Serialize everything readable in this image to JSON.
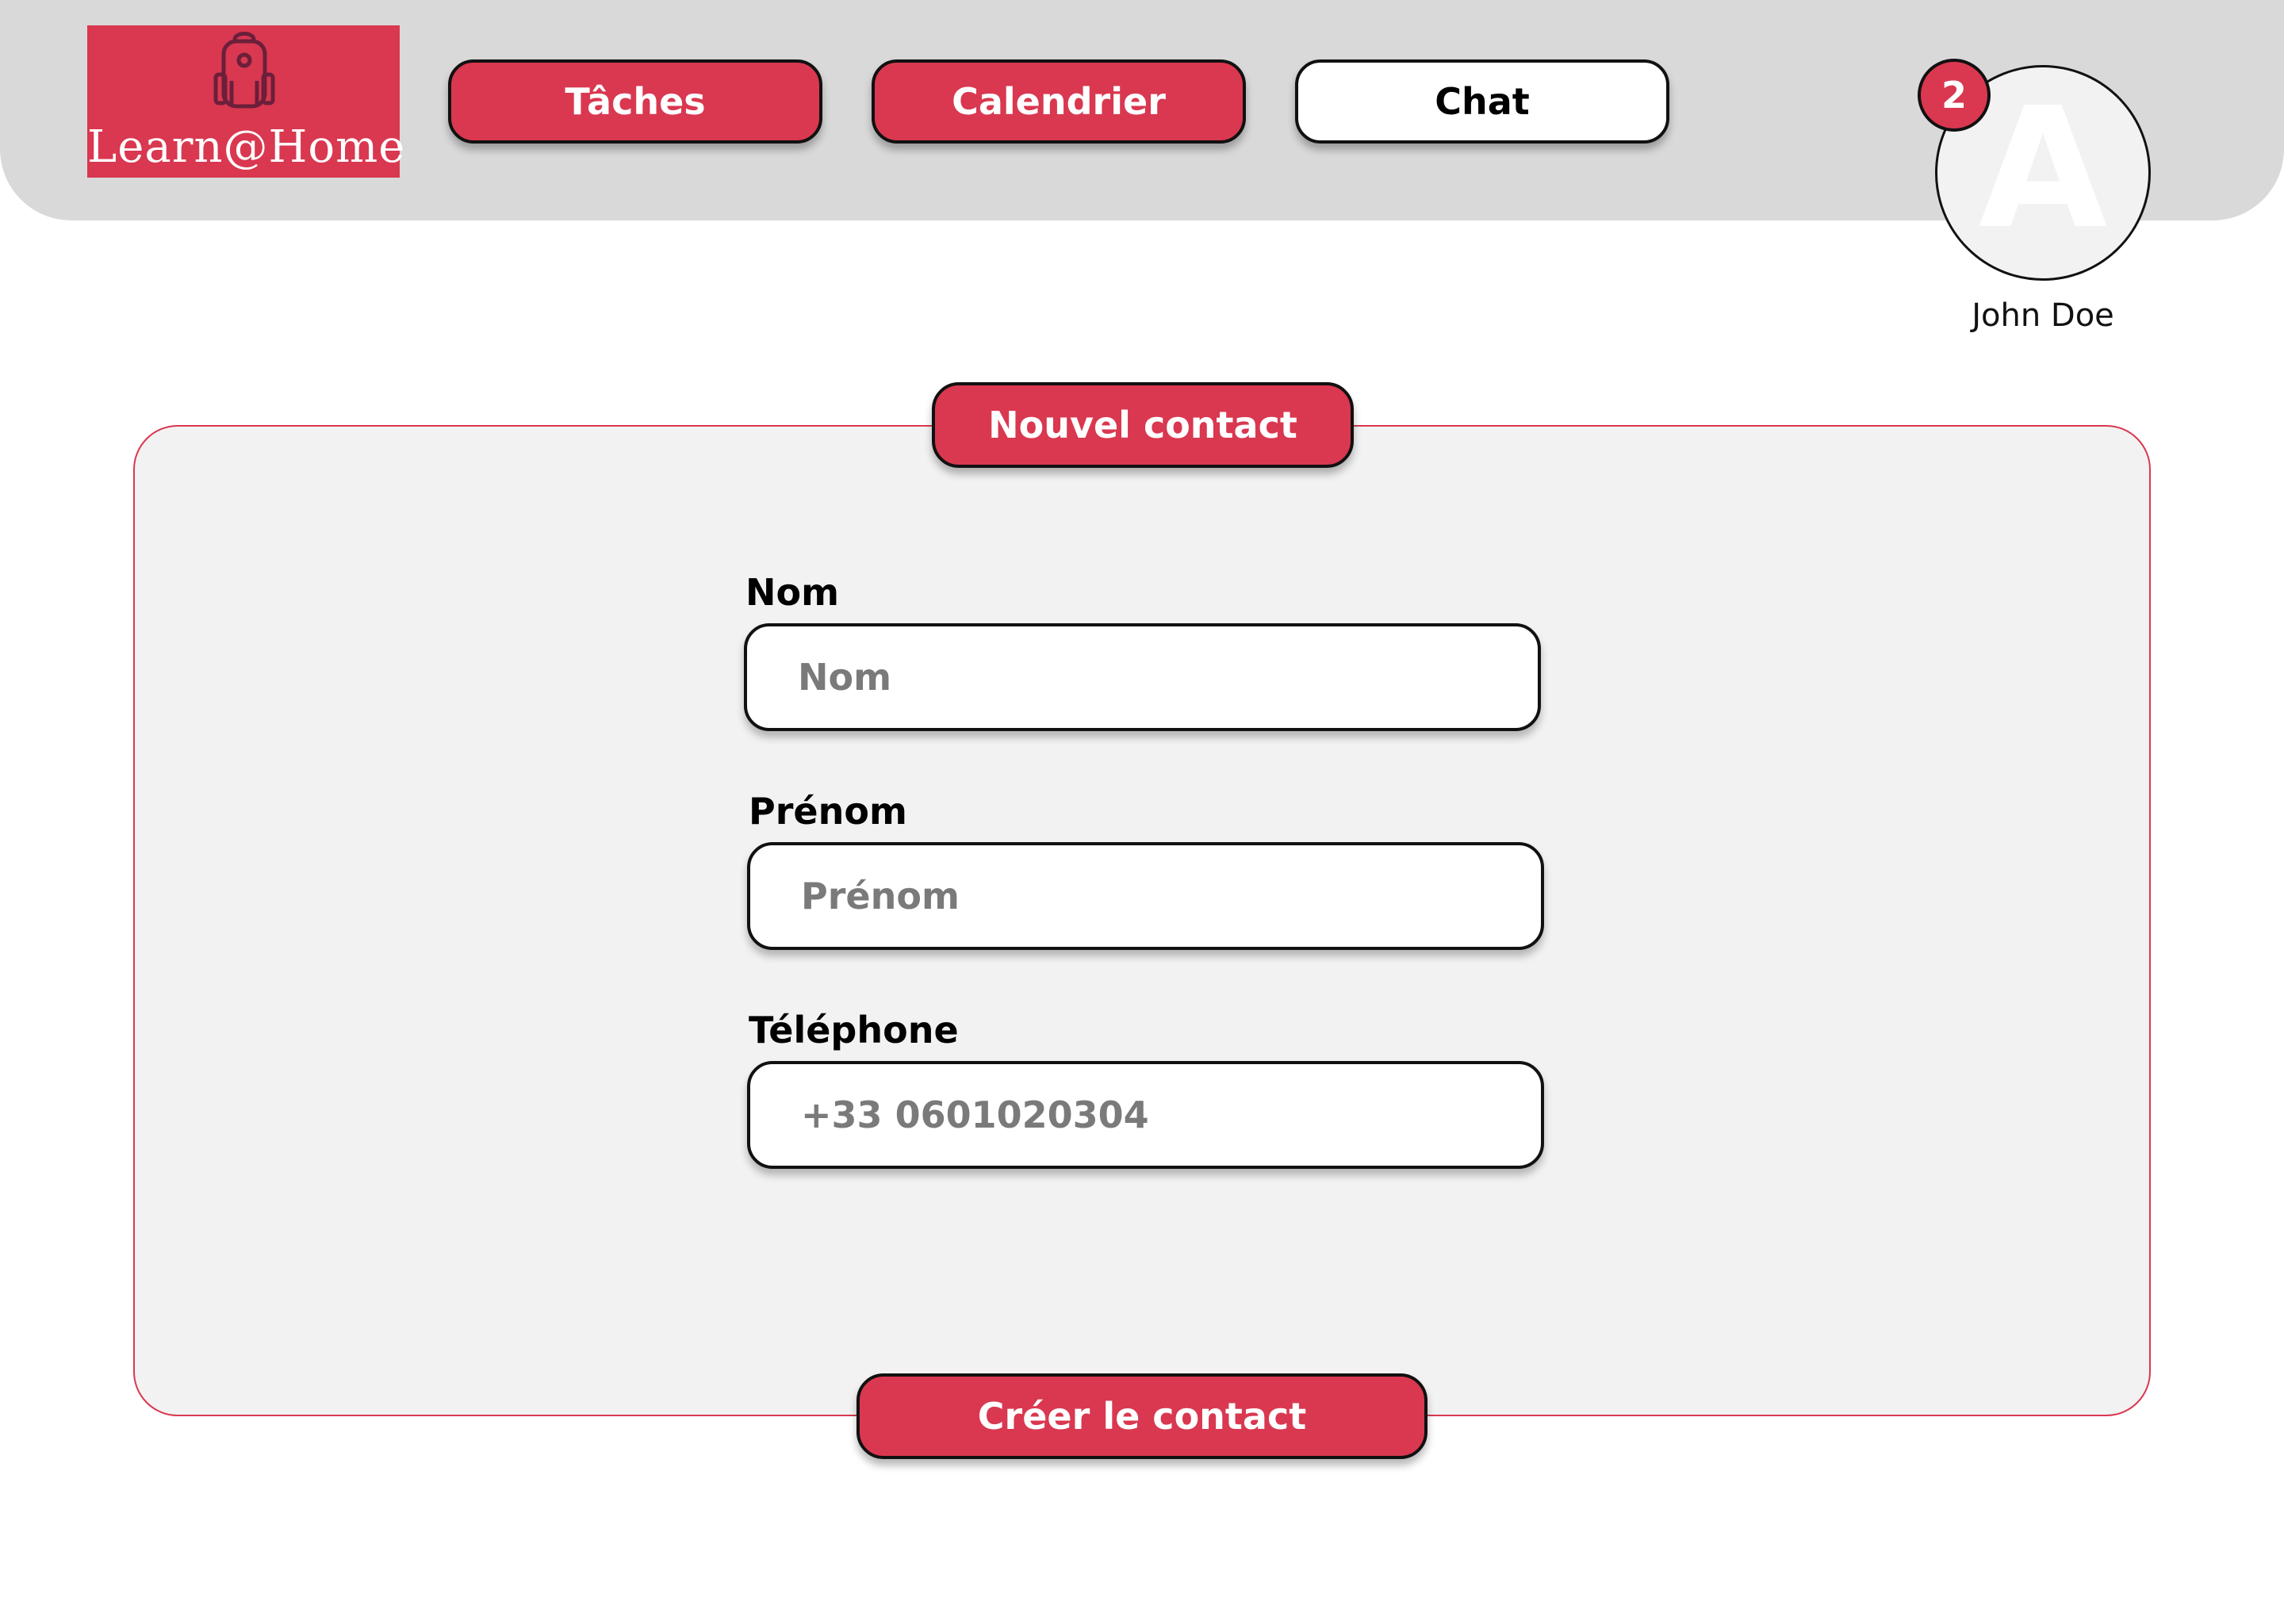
{
  "app": {
    "logo_text": "Learn@Home",
    "logo_icon": "backpack-icon"
  },
  "nav": {
    "items": [
      {
        "label": "Tâches",
        "active": false
      },
      {
        "label": "Calendrier",
        "active": false
      },
      {
        "label": "Chat",
        "active": true
      }
    ]
  },
  "user": {
    "avatar_letter": "A",
    "notification_count": "2",
    "name": "John Doe"
  },
  "form": {
    "title": "Nouvel contact",
    "fields": [
      {
        "label": "Nom",
        "placeholder": "Nom"
      },
      {
        "label": "Prénom",
        "placeholder": "Prénom"
      },
      {
        "label": "Téléphone",
        "placeholder": "+33 0601020304"
      }
    ],
    "submit_label": "Créer le contact"
  },
  "colors": {
    "accent": "#d93850",
    "header_bg": "#d9d9d9",
    "panel_bg": "#f2f2f2"
  }
}
